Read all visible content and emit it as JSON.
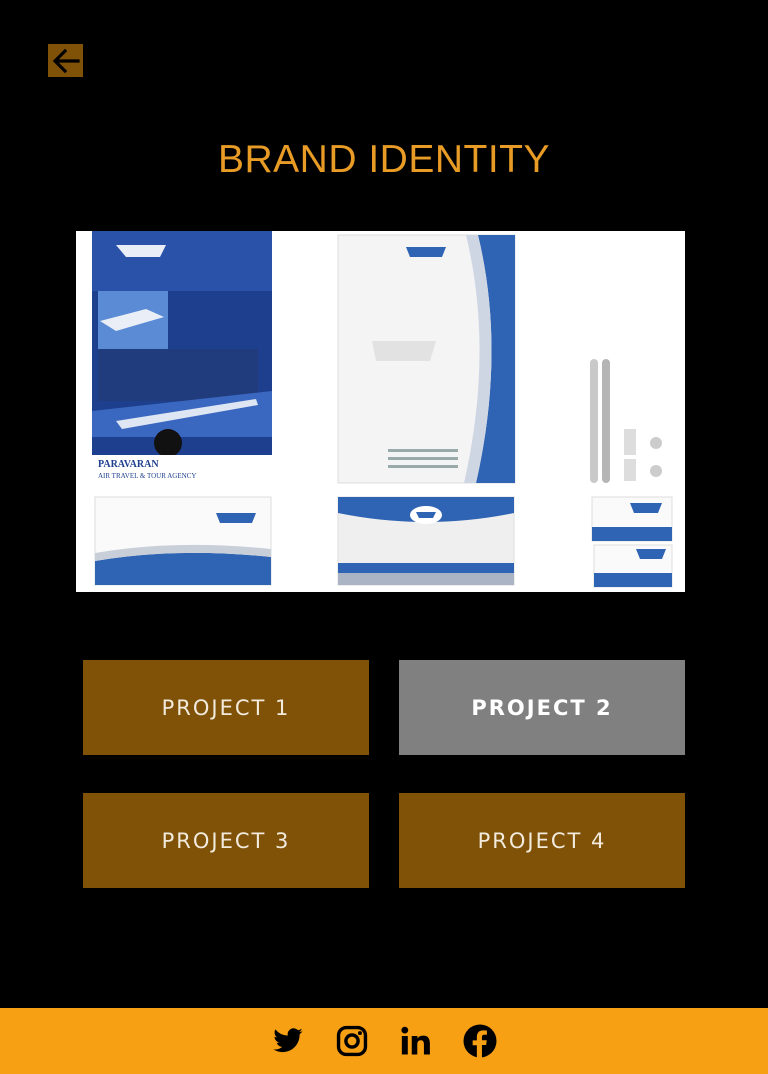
{
  "header": {
    "title": "BRAND IDENTITY",
    "back_icon": "arrow-left-icon"
  },
  "showcase": {
    "brand_name": "PARAVARAN",
    "brand_tagline": "AIR TRAVEL & TOUR AGENCY",
    "accent_blue": "#2f63b3"
  },
  "projects": [
    {
      "label": "PROJECT 1",
      "active": false
    },
    {
      "label": "PROJECT 2",
      "active": true
    },
    {
      "label": "PROJECT 3",
      "active": false
    },
    {
      "label": "PROJECT 4",
      "active": false
    }
  ],
  "footer": {
    "icons": [
      "twitter-icon",
      "instagram-icon",
      "linkedin-icon",
      "facebook-icon"
    ]
  },
  "colors": {
    "accent": "#e89b25",
    "button": "#7f5208",
    "active_button": "#808080",
    "footer": "#f7a014"
  }
}
